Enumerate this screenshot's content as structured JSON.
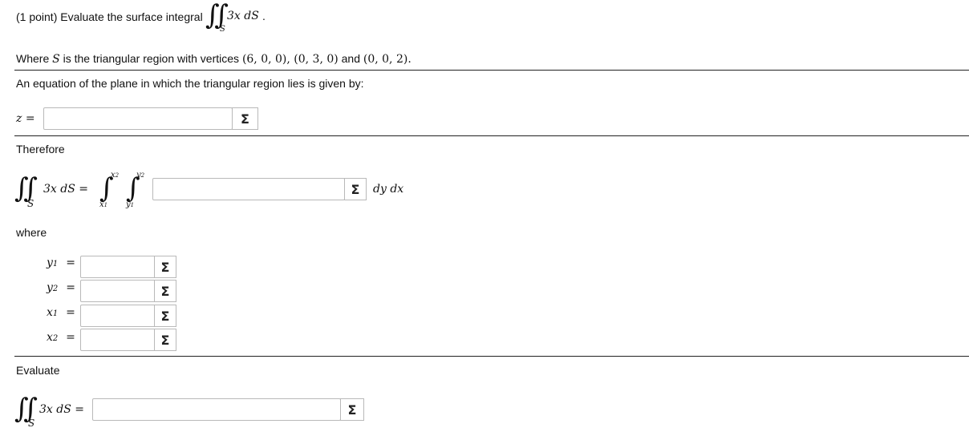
{
  "header": {
    "prompt": "(1 point) Evaluate the surface integral",
    "integrand": "3x dS",
    "period": ".",
    "region_S": "S"
  },
  "region": {
    "text_before": "Where",
    "S": "S",
    "text_after": "is the triangular region with vertices",
    "vertices": "(6, 0, 0), (0, 3, 0)",
    "and": "and",
    "last_vertex": "(0, 0, 2)."
  },
  "plane": {
    "text": "An equation of the plane in which the triangular region lies is given by:",
    "z_label": "z ="
  },
  "therefore": {
    "label": "Therefore",
    "lhs": "3x dS =",
    "lower_x": "x",
    "lower_x_sub": "1",
    "upper_x": "x",
    "upper_x_sub": "2",
    "lower_y": "y",
    "lower_y_sub": "1",
    "upper_y": "y",
    "upper_y_sub": "2",
    "differentials": "dy dx"
  },
  "where": {
    "label": "where",
    "rows": [
      {
        "var": "y",
        "sub": "1",
        "eq": "="
      },
      {
        "var": "y",
        "sub": "2",
        "eq": "="
      },
      {
        "var": "x",
        "sub": "1",
        "eq": "="
      },
      {
        "var": "x",
        "sub": "2",
        "eq": "="
      }
    ]
  },
  "evaluate": {
    "label": "Evaluate",
    "lhs": "3x dS ="
  },
  "icons": {
    "sigma": "Σ"
  }
}
